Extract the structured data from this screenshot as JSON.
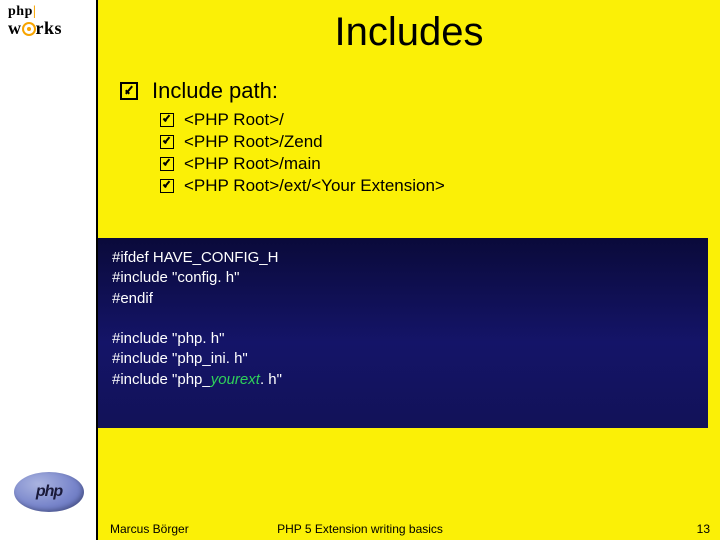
{
  "title": "Includes",
  "heading": "Include path:",
  "paths": [
    "<PHP Root>/",
    "<PHP Root>/Zend",
    "<PHP Root>/main",
    "<PHP Root>/ext/<Your Extension>"
  ],
  "code": {
    "l1": "#ifdef ",
    "l1m": "HAVE_CONFIG_H",
    "l2": "#include \"config. h\"",
    "l3": "#endif",
    "l5": "#include \"php. h\"",
    "l6": "#include \"php_ini. h\"",
    "l7a": "#include \"php_",
    "l7b": "yourext",
    "l7c": ". h\""
  },
  "logo": {
    "top1": "php",
    "top2": "w",
    "top3": "rks",
    "bottom": "php"
  },
  "footer": {
    "author": "Marcus Börger",
    "title": "PHP 5 Extension writing basics",
    "page": "13"
  }
}
